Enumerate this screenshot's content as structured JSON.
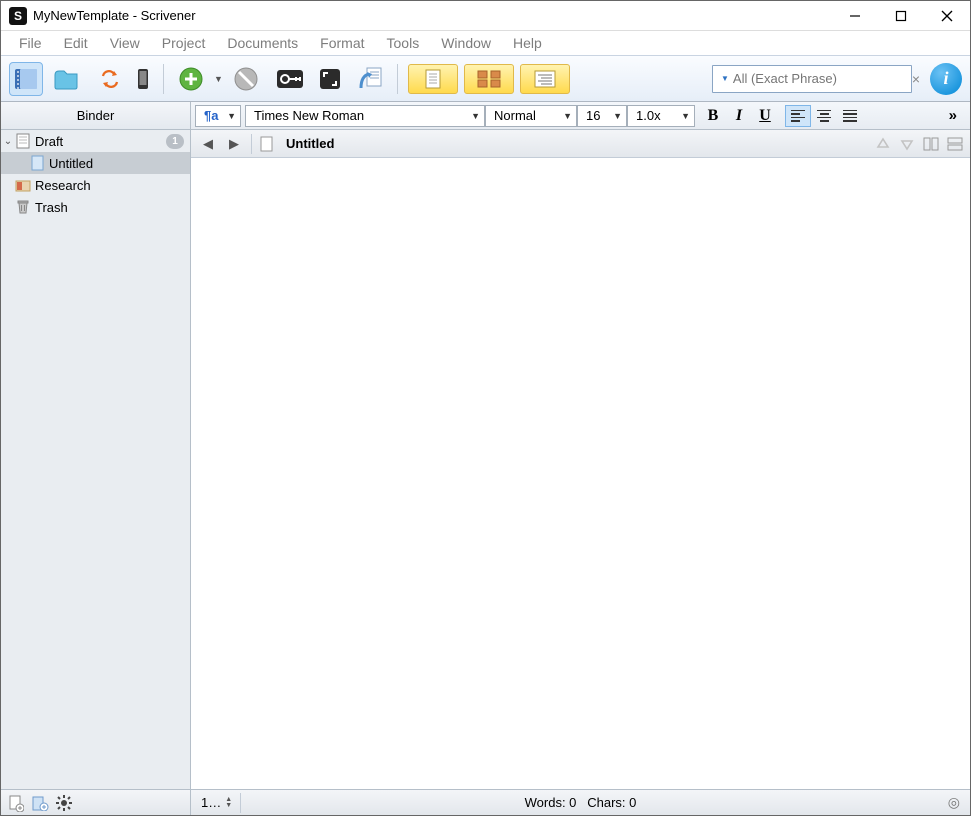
{
  "window": {
    "title": "MyNewTemplate - Scrivener",
    "app_icon_letter": "S"
  },
  "menu": {
    "items": [
      "File",
      "Edit",
      "View",
      "Project",
      "Documents",
      "Format",
      "Tools",
      "Window",
      "Help"
    ]
  },
  "search": {
    "placeholder": "All (Exact Phrase)",
    "clear_glyph": "×"
  },
  "binder": {
    "header": "Binder",
    "items": [
      {
        "label": "Draft",
        "type": "folder-draft",
        "expanded": true,
        "count": "1",
        "depth": 0
      },
      {
        "label": "Untitled",
        "type": "document",
        "selected": true,
        "depth": 1
      },
      {
        "label": "Research",
        "type": "folder-research",
        "depth": 0
      },
      {
        "label": "Trash",
        "type": "trash",
        "depth": 0
      }
    ]
  },
  "format": {
    "pilcrow": "¶a",
    "font": "Times New Roman",
    "style": "Normal",
    "size": "16",
    "zoom": "1.0x",
    "bold": "B",
    "italic": "I",
    "underline": "U",
    "more": "»"
  },
  "editor": {
    "doc_title": "Untitled"
  },
  "status": {
    "left_label": "1…",
    "words_label": "Words: 0",
    "chars_label": "Chars: 0"
  },
  "info_glyph": "i"
}
